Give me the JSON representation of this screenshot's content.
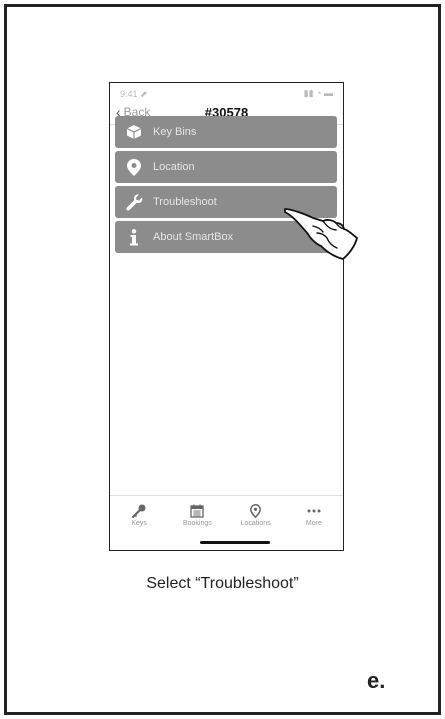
{
  "nav": {
    "back_label": "Back",
    "title": "#30578"
  },
  "menu": {
    "items": [
      {
        "label": "Key Bins",
        "icon": "box-icon"
      },
      {
        "label": "Location",
        "icon": "location-pin-icon"
      },
      {
        "label": "Troubleshoot",
        "icon": "wrench-icon"
      },
      {
        "label": "About SmartBox",
        "icon": "info-icon"
      }
    ]
  },
  "tabs": [
    {
      "label": "Keys",
      "icon": "key-icon"
    },
    {
      "label": "Bookings",
      "icon": "calendar-icon"
    },
    {
      "label": "Locations",
      "icon": "location-pin-icon"
    },
    {
      "label": "More",
      "icon": "ellipsis-icon"
    }
  ],
  "caption": "Select “Troubleshoot”",
  "step_label": "e.",
  "colors": {
    "menu_bg": "#8c8c8c",
    "frame": "#222222"
  }
}
